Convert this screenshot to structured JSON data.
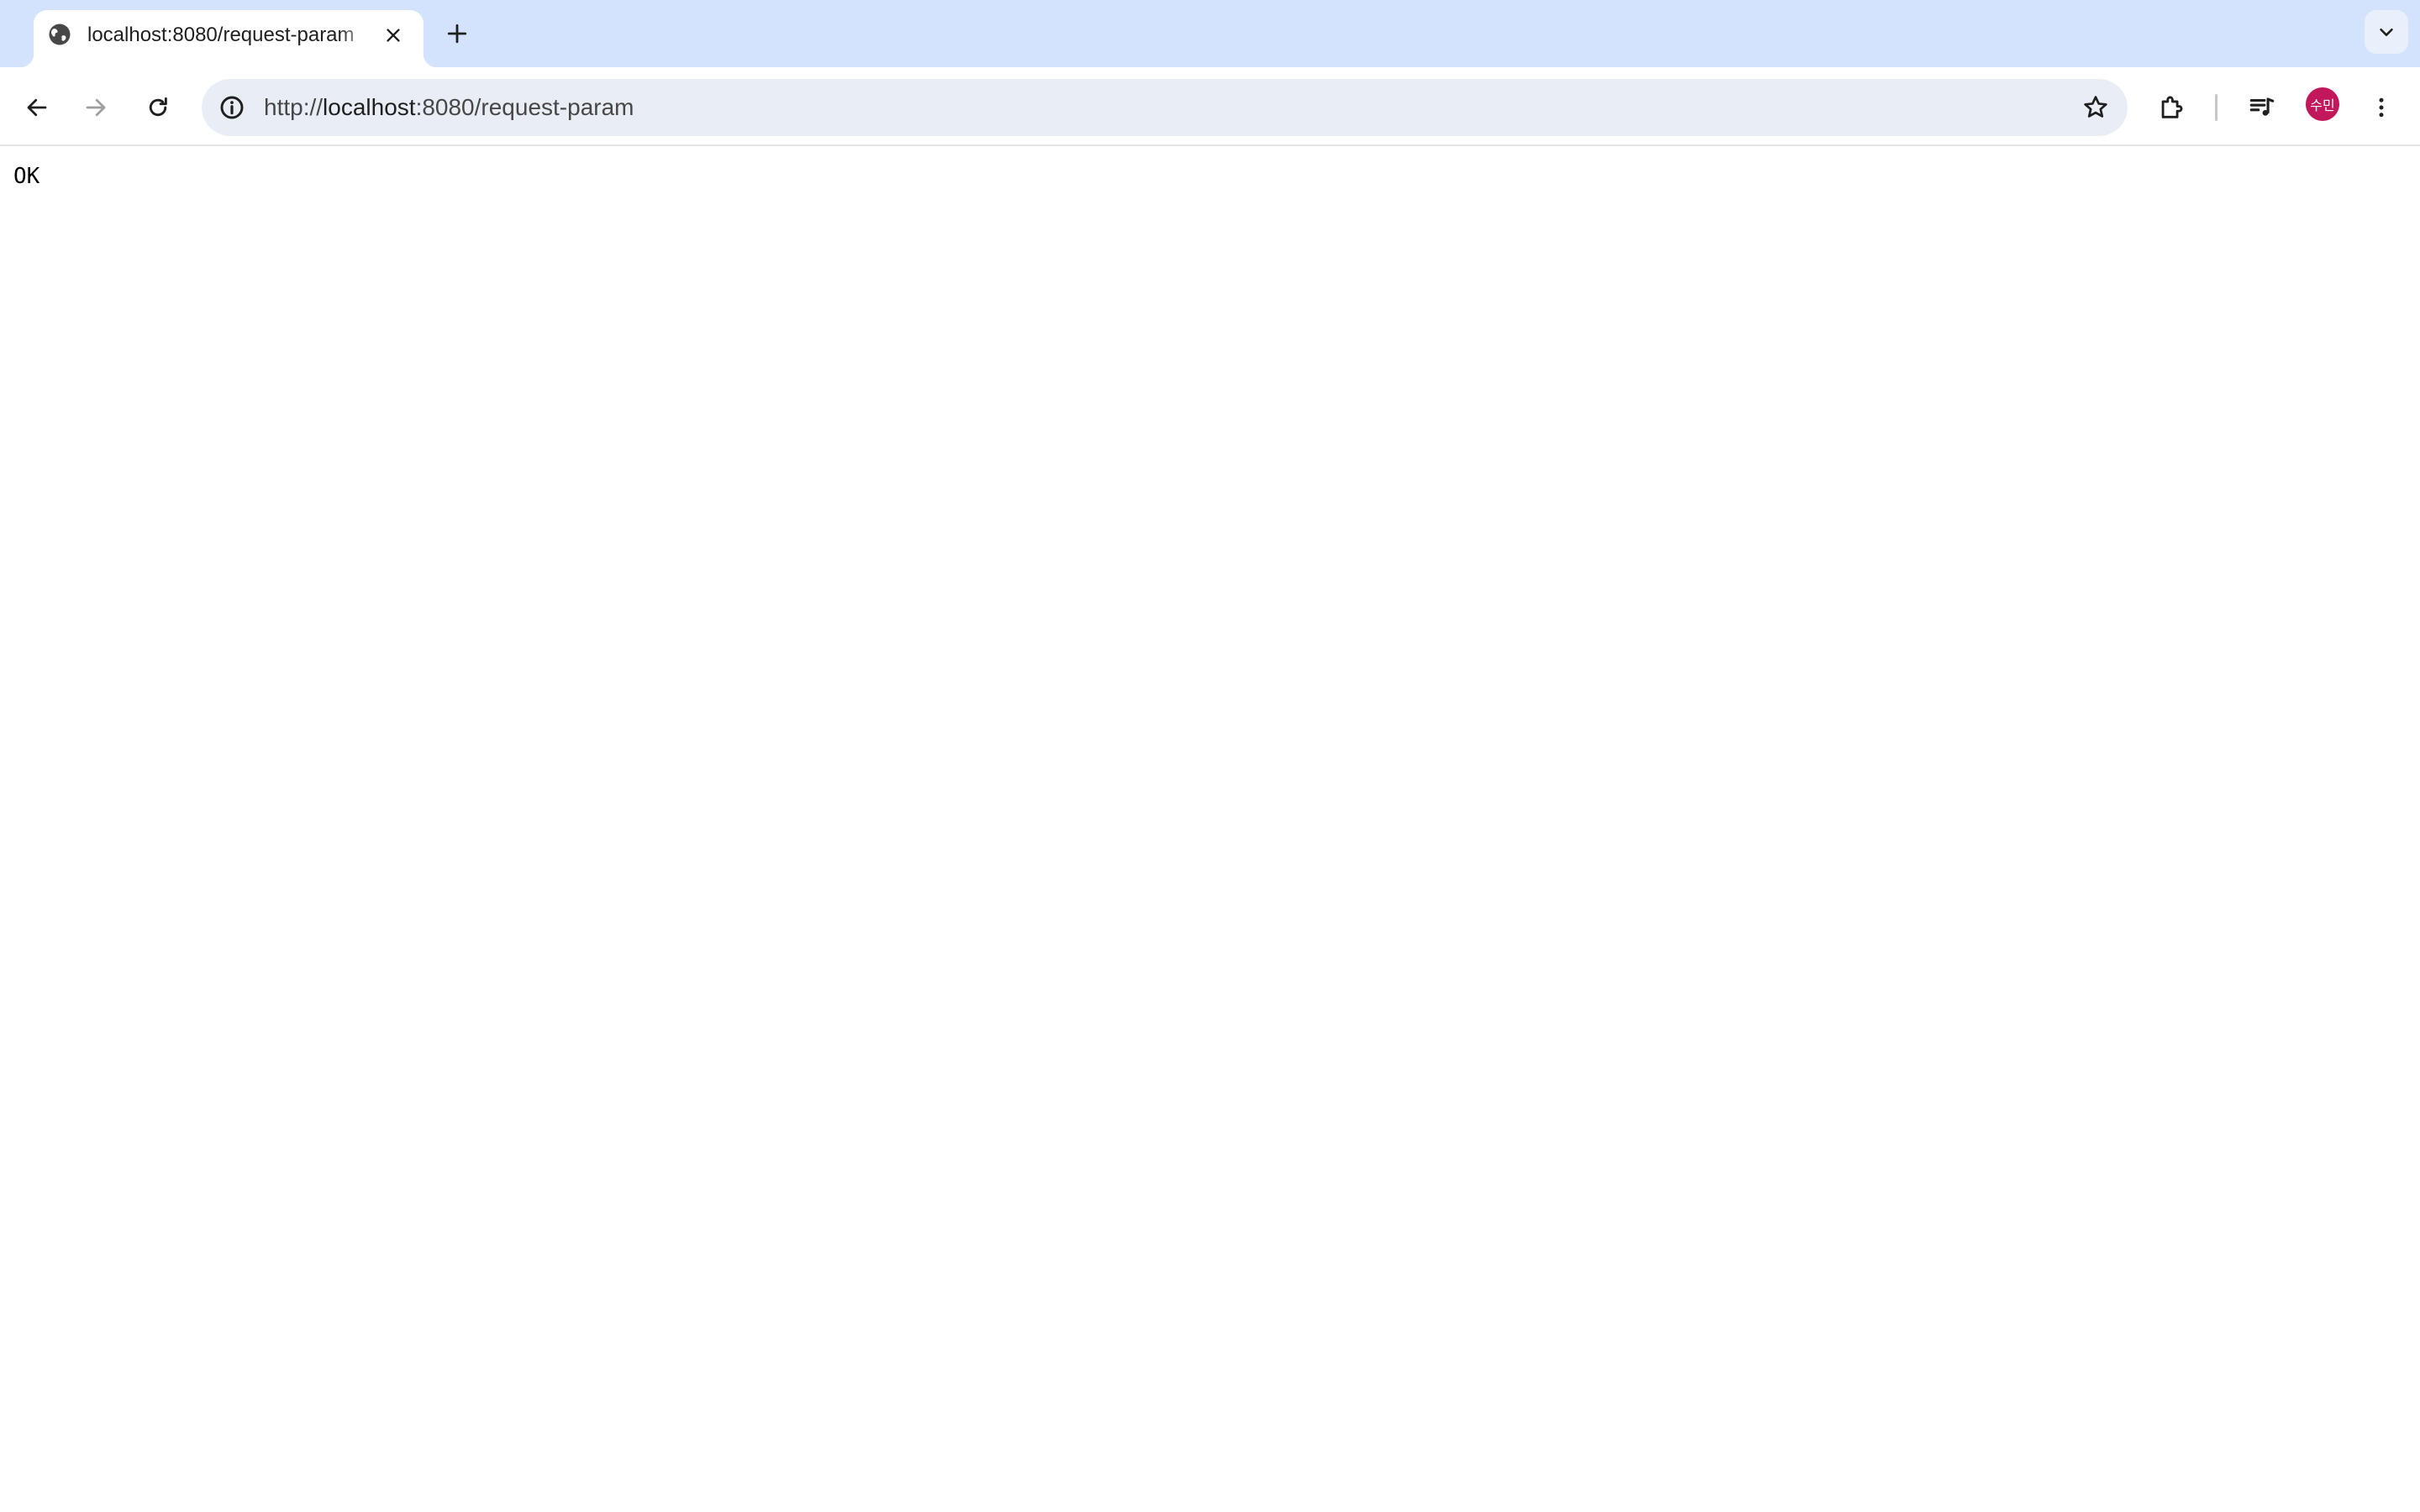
{
  "browser": {
    "tab": {
      "title": "localhost:8080/request-param",
      "favicon": "globe-icon",
      "close_icon": "close-icon"
    },
    "new_tab_icon": "plus-icon",
    "tab_search_icon": "chevron-down-icon",
    "toolbar": {
      "back_icon": "arrow-left-icon",
      "forward_icon": "arrow-right-icon",
      "reload_icon": "reload-icon",
      "site_info_icon": "info-icon",
      "bookmark_icon": "star-icon",
      "extensions_icon": "puzzle-icon",
      "media_icon": "media-control-icon",
      "menu_icon": "vertical-dots-icon"
    },
    "omnibox": {
      "scheme": "http://",
      "host": "localhost",
      "path": ":8080/request-param"
    },
    "profile": {
      "avatar_text": "수민",
      "avatar_color": "#c2185b"
    },
    "colors": {
      "tabstrip_bg": "#d3e3fd",
      "omnibox_bg": "#e9eef6"
    }
  },
  "page": {
    "body_text": "OK"
  }
}
